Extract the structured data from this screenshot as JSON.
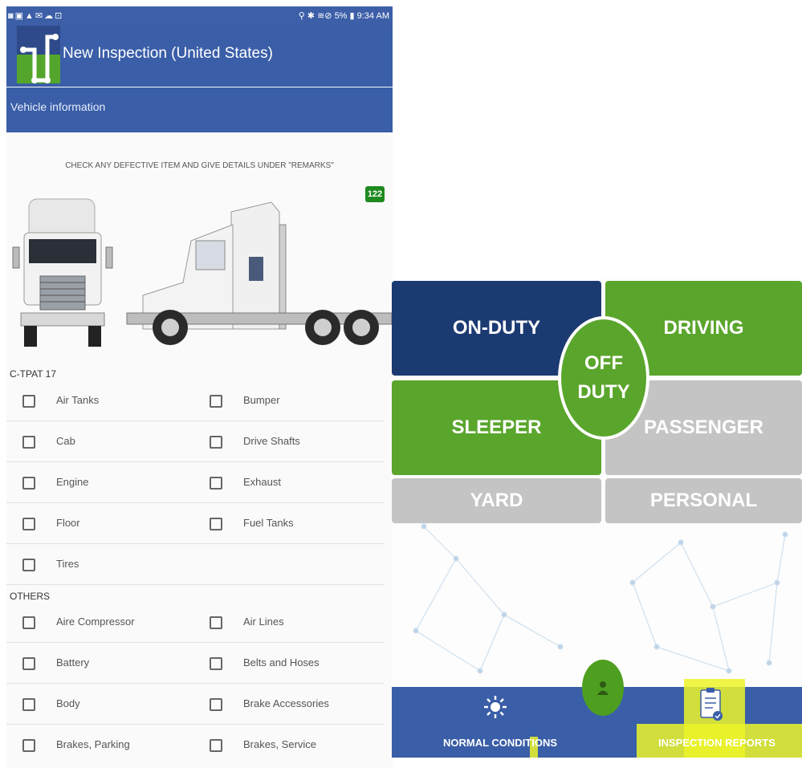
{
  "status_bar": {
    "left_icons": "◙▣▲✉☁⊡",
    "right_text": "⚲ ✱ ≋⊘ 5% ▮ 9:34 AM"
  },
  "app": {
    "title": "New Inspection (United States)",
    "tab_label": "Vehicle information"
  },
  "instructions": "CHECK ANY DEFECTIVE ITEM AND GIVE DETAILS UNDER \"REMARKS\"",
  "badge_count": "122",
  "sections": [
    {
      "title": "C-TPAT 17",
      "rows": [
        [
          "Air Tanks",
          "Bumper"
        ],
        [
          "Cab",
          "Drive Shafts"
        ],
        [
          "Engine",
          "Exhaust"
        ],
        [
          "Floor",
          "Fuel Tanks"
        ],
        [
          "Tires",
          ""
        ]
      ]
    },
    {
      "title": "OTHERS",
      "rows": [
        [
          "Aire Compressor",
          "Air Lines"
        ],
        [
          "Battery",
          "Belts and Hoses"
        ],
        [
          "Body",
          "Brake Accessories"
        ],
        [
          "Brakes, Parking",
          "Brakes, Service"
        ]
      ]
    }
  ],
  "duty_status": {
    "on_duty": "ON-DUTY",
    "driving": "DRIVING",
    "off_duty_line1": "OFF",
    "off_duty_line2": "DUTY",
    "sleeper": "SLEEPER",
    "passenger": "PASSENGER",
    "yard": "YARD",
    "personal": "PERSONAL"
  },
  "bottom_nav": {
    "normal_conditions": "NORMAL CONDITIONS",
    "inspection_reports": "INSPECTION REPORTS"
  },
  "colors": {
    "primary_blue": "#3a5ea7",
    "navy": "#1c3a72",
    "green": "#5aa52c",
    "gray": "#c4c4c4",
    "badge_green": "#1f8a1f",
    "highlight_yellow": "#ecf428"
  },
  "icons": {
    "sun": "sun-icon",
    "clipboard": "clipboard-check-icon",
    "driver": "driver-icon"
  }
}
